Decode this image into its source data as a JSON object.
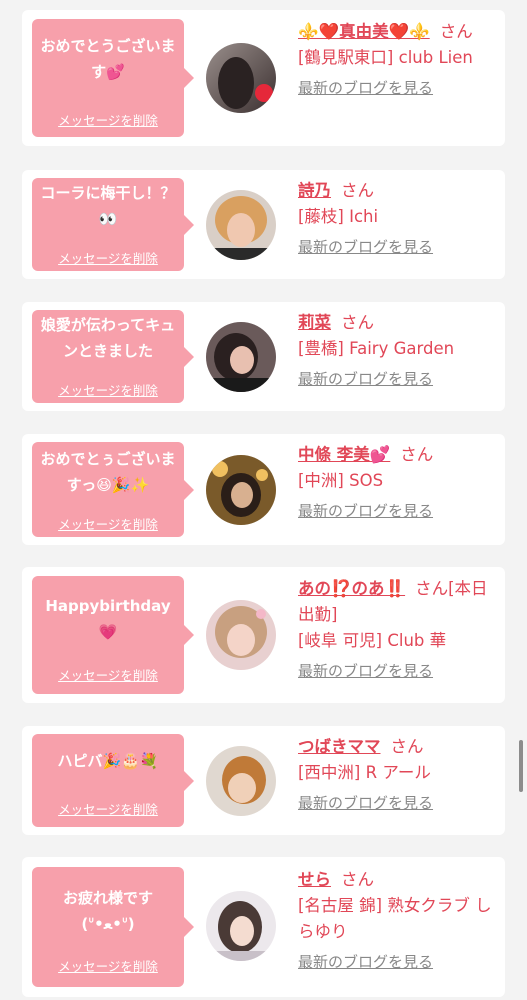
{
  "cards": [
    {
      "message": "おめでとうございます💕",
      "delete_label": "メッセージを削除",
      "name": "⚜️❤️真由美❤️⚜️",
      "honorific": "さん",
      "shop": "[鶴見駅東口] club Lien",
      "blog_label": "最新のブログを見る"
    },
    {
      "message": "コーラに梅干し！？👀",
      "delete_label": "メッセージを削除",
      "name": "詩乃",
      "honorific": "さん",
      "shop": "[藤枝] Ichi",
      "blog_label": "最新のブログを見る"
    },
    {
      "message": "娘愛が伝わってキュンときました",
      "delete_label": "メッセージを削除",
      "name": "莉菜",
      "honorific": "さん",
      "shop": "[豊橋] Fairy Garden",
      "blog_label": "最新のブログを見る"
    },
    {
      "message": "おめでとぅございますっ😆🎉✨",
      "delete_label": "メッセージを削除",
      "name": "中條 李美💕",
      "honorific": "さん",
      "shop": "[中洲] SOS",
      "blog_label": "最新のブログを見る"
    },
    {
      "message": "Happybirthday💗",
      "delete_label": "メッセージを削除",
      "name": "あの⁉️のあ‼️",
      "honorific": "さん[本日出勤]",
      "shop": "[岐阜 可児] Club 華",
      "blog_label": "最新のブログを見る"
    },
    {
      "message": "ハピバ🎉🎂💐",
      "delete_label": "メッセージを削除",
      "name": "つばきママ",
      "honorific": "さん",
      "shop": "[西中洲] R アール",
      "blog_label": "最新のブログを見る"
    },
    {
      "message": "お疲れ様です(ᐡ•ﻌ•ᐡ)",
      "delete_label": "メッセージを削除",
      "name": "せら",
      "honorific": "さん",
      "shop": "[名古屋 錦] 熟女クラブ しらゆり",
      "blog_label": "最新のブログを見る"
    }
  ],
  "colors": {
    "accent": "#e14757",
    "bubble": "#f7a0ab",
    "muted": "#888888",
    "background": "#f3f3f3"
  }
}
